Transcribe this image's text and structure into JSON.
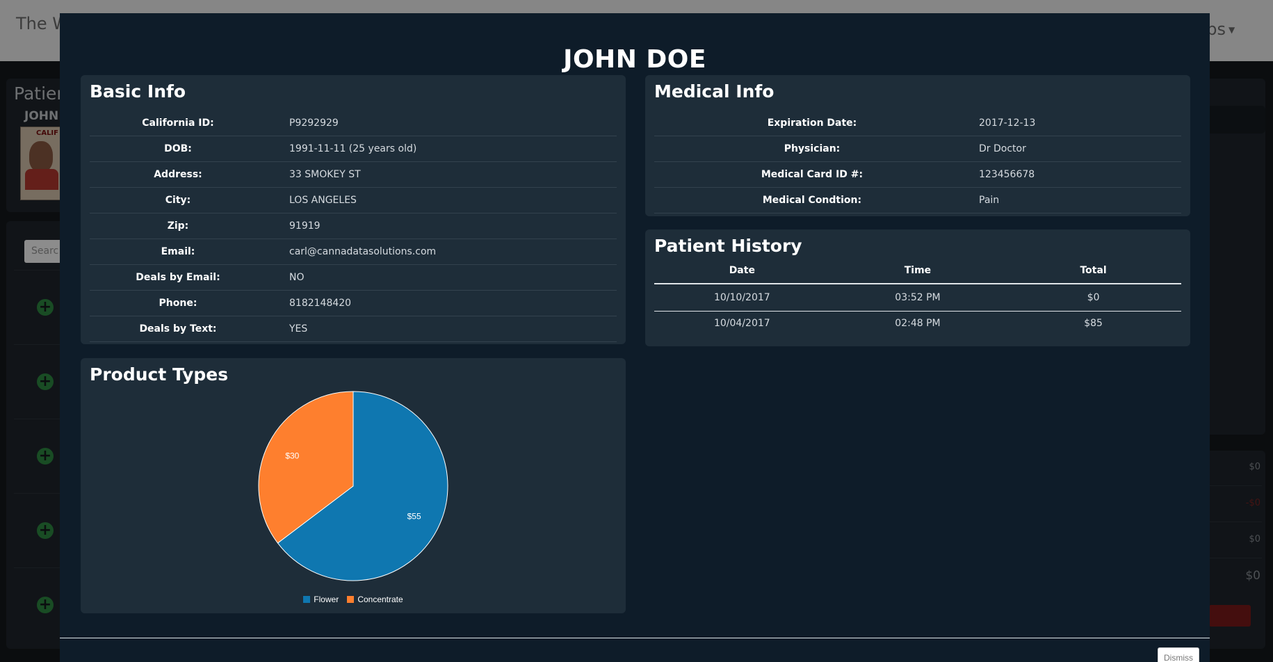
{
  "background": {
    "brand_text": "The W",
    "apps_menu_label": "pps",
    "patient_panel_title": "Patier",
    "patient_name_short": "JOHN",
    "photo_header": "CALIF",
    "search_placeholder": "Searc",
    "side_amounts": [
      "$0",
      "-$0",
      "$0",
      "$0"
    ]
  },
  "modal": {
    "title": "JOHN DOE",
    "basic_info": {
      "title": "Basic Info",
      "rows": [
        {
          "label": "California ID:",
          "value": "P9292929"
        },
        {
          "label": "DOB:",
          "value": "1991-11-11 (25 years old)"
        },
        {
          "label": "Address:",
          "value": "33 SMOKEY ST"
        },
        {
          "label": "City:",
          "value": "LOS ANGELES"
        },
        {
          "label": "Zip:",
          "value": "91919"
        },
        {
          "label": "Email:",
          "value": "carl@cannadatasolutions.com"
        },
        {
          "label": "Deals by Email:",
          "value": "NO"
        },
        {
          "label": "Phone:",
          "value": "8182148420"
        },
        {
          "label": "Deals by Text:",
          "value": "YES"
        }
      ]
    },
    "medical_info": {
      "title": "Medical Info",
      "rows": [
        {
          "label": "Expiration Date:",
          "value": "2017-12-13"
        },
        {
          "label": "Physician:",
          "value": "Dr Doctor"
        },
        {
          "label": "Medical Card ID #:",
          "value": "123456678"
        },
        {
          "label": "Medical Condtion:",
          "value": "Pain"
        }
      ]
    },
    "patient_history": {
      "title": "Patient History",
      "columns": [
        "Date",
        "Time",
        "Total"
      ],
      "rows": [
        [
          "10/10/2017",
          "03:52 PM",
          "$0"
        ],
        [
          "10/04/2017",
          "02:48 PM",
          "$85"
        ]
      ]
    },
    "product_types": {
      "title": "Product Types"
    },
    "dismiss_label": "Dismiss"
  },
  "chart_data": {
    "type": "pie",
    "categories": [
      "Flower",
      "Concentrate"
    ],
    "values": [
      55,
      30
    ],
    "data_labels": [
      "$55",
      "$30"
    ],
    "colors": [
      "#0f77b0",
      "#fe7f2e"
    ],
    "legend": "bottom"
  }
}
